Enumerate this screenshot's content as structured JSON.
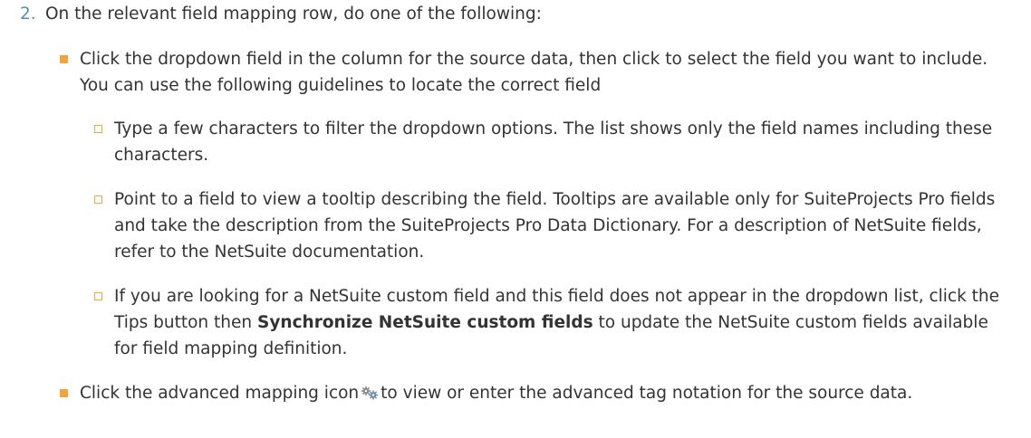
{
  "step": {
    "number": "2.",
    "text": "On the relevant field mapping row, do one of the following:"
  },
  "bullets": [
    {
      "text": "Click the dropdown field in the column for the source data, then click to select the field you want to include. You can use the following guidelines to locate the correct field"
    },
    {
      "text_before": "Click the advanced mapping icon",
      "icon": "advanced-mapping-gears-icon",
      "text_after": "to view or enter the advanced tag notation for the source data."
    }
  ],
  "sub_bullets": [
    {
      "text": "Type a few characters to filter the dropdown options. The list shows only the field names including these characters."
    },
    {
      "text": "Point to a field to view a tooltip describing the field. Tooltips are available only for SuiteProjects Pro fields and take the description from the SuiteProjects Pro Data Dictionary. For a description of NetSuite fields, refer to the NetSuite documentation."
    },
    {
      "text_before": "If you are looking for a NetSuite custom field and this field does not appear in the dropdown list, click the Tips button then",
      "bold": "Synchronize NetSuite custom fields",
      "text_after": "to update the NetSuite custom fields available for field mapping definition."
    }
  ],
  "colors": {
    "step_number": "#4a90c6",
    "bullet_marker": "#f2a33a",
    "text": "#333333"
  }
}
